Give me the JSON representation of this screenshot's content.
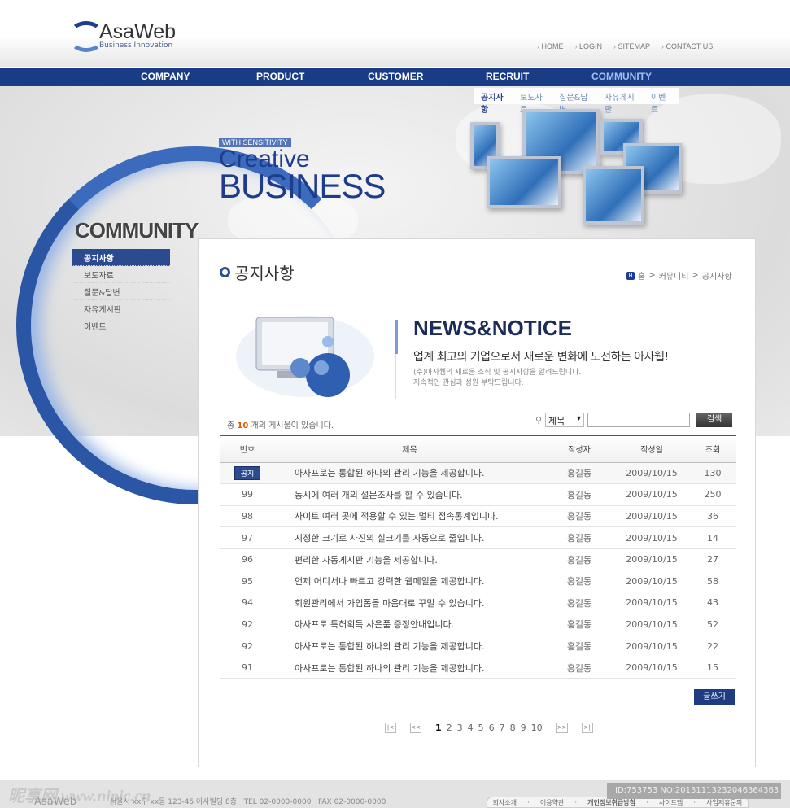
{
  "brand": {
    "name": "AsaWeb",
    "tagline": "Business Innovation"
  },
  "top_links": [
    "HOME",
    "LOGIN",
    "SITEMAP",
    "CONTACT US"
  ],
  "nav": [
    {
      "label": "COMPANY"
    },
    {
      "label": "PRODUCT"
    },
    {
      "label": "CUSTOMER"
    },
    {
      "label": "RECRUIT"
    },
    {
      "label": "COMMUNITY",
      "active": true
    }
  ],
  "submenu": [
    "공지사항",
    "보도자료",
    "질문&답변",
    "자유게시판",
    "이벤트"
  ],
  "hero": {
    "small": "WITH SENSITIVITY",
    "line1": "Creative",
    "line2": "BUSINESS"
  },
  "sidebar": {
    "title": "COMMUNITY",
    "items": [
      {
        "label": "공지사항",
        "active": true
      },
      {
        "label": "보도자료"
      },
      {
        "label": "질문&답변"
      },
      {
        "label": "자유게시판"
      },
      {
        "label": "이벤트"
      }
    ]
  },
  "page": {
    "title": "공지사항",
    "breadcrumb": [
      "홈",
      "커뮤니티",
      "공지사항"
    ],
    "breadcrumb_sep": ">",
    "home_icon": "H"
  },
  "news": {
    "title": "NEWS&NOTICE",
    "subtitle": "업계 최고의 기업으로서 새로운 변화에 도전하는 아사웹!",
    "desc1": "(주)아사웹의 새로운 소식 및 공지사항을 알려드립니다.",
    "desc2": "지속적인 관심과 성원 부탁드립니다."
  },
  "board": {
    "total_prefix": "총",
    "total_count": "10",
    "total_suffix": "개의 게시물이 있습니다.",
    "search_field": "제목",
    "search_value": "",
    "search_button": "검색",
    "write_button": "글쓰기",
    "columns": [
      "번호",
      "제목",
      "작성자",
      "작성일",
      "조회"
    ],
    "rows": [
      {
        "no": "공지",
        "title": "아사프로는 통합된 하나의 관리 기능을 제공합니다.",
        "author": "홍길동",
        "date": "2009/10/15",
        "views": "130"
      },
      {
        "no": "99",
        "title": "동시에 여러 개의 설문조사를 할 수 있습니다.",
        "author": "홍길동",
        "date": "2009/10/15",
        "views": "250"
      },
      {
        "no": "98",
        "title": "사이트 여러 곳에 적용할 수 있는 멀티 접속통계입니다.",
        "author": "홍길동",
        "date": "2009/10/15",
        "views": "36"
      },
      {
        "no": "97",
        "title": "지정한 크기로 사진의 실크기를 자동으로 줄입니다.",
        "author": "홍길동",
        "date": "2009/10/15",
        "views": "14"
      },
      {
        "no": "96",
        "title": "편리한 자동게시판 기능을 제공합니다.",
        "author": "홍길동",
        "date": "2009/10/15",
        "views": "27"
      },
      {
        "no": "95",
        "title": "언제 어디서나 빠르고 강력한 웹메일을 제공합니다.",
        "author": "홍길동",
        "date": "2009/10/15",
        "views": "58"
      },
      {
        "no": "94",
        "title": "회원관리에서 가입폼을 마음대로 꾸밀 수 있습니다.",
        "author": "홍길동",
        "date": "2009/10/15",
        "views": "43"
      },
      {
        "no": "92",
        "title": "아사프로 특허획득 사은품 증정안내입니다.",
        "author": "홍길동",
        "date": "2009/10/15",
        "views": "52"
      },
      {
        "no": "92",
        "title": "아사프로는 통합된 하나의 관리 기능을 제공합니다.",
        "author": "홍길동",
        "date": "2009/10/15",
        "views": "22"
      },
      {
        "no": "91",
        "title": "아사프로는 통합된 하나의 관리 기능을 제공합니다.",
        "author": "홍길동",
        "date": "2009/10/15",
        "views": "15"
      }
    ]
  },
  "pagination": {
    "first": "|<",
    "prev": "<<",
    "pages": [
      "1",
      "2",
      "3",
      "4",
      "5",
      "6",
      "7",
      "8",
      "9",
      "10"
    ],
    "current": "1",
    "next": ">>",
    "last": ">|"
  },
  "footer": {
    "logo": "AsaWeb",
    "address": "서울시 xx구 xx동 123-45 아사빌딩 8층",
    "tel": "TEL 02-0000-0000",
    "fax": "FAX 02-0000-0000",
    "links": [
      "회사소개",
      "이용약관",
      "개인정보취급방침",
      "사이트맵",
      "사업제휴문의"
    ]
  },
  "watermark": {
    "text": "昵享网 www.nipic.cn",
    "id": "ID:753753 NO:20131113232046364363"
  },
  "colors": {
    "nav": "#1a3c86",
    "accent": "#2b4a90",
    "highlight": "#e05a00"
  }
}
